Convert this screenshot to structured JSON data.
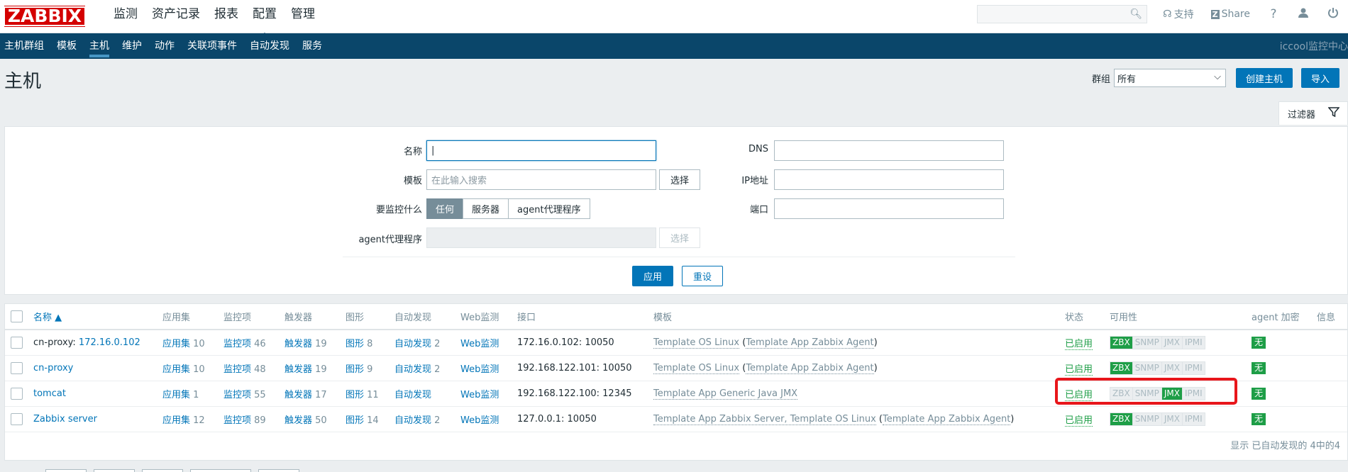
{
  "logo": "ZABBIX",
  "topmenu": [
    "监测",
    "资产记录",
    "报表",
    "配置",
    "管理"
  ],
  "topright": {
    "support": "支持",
    "share": "Share",
    "help": "?"
  },
  "subnav": [
    "主机群组",
    "模板",
    "主机",
    "维护",
    "动作",
    "关联项事件",
    "自动发现",
    "服务"
  ],
  "subnav_right": "iccool监控中心",
  "page_title": "主机",
  "group_label": "群组",
  "group_value": "所有",
  "create_host": "创建主机",
  "import": "导入",
  "filter_tab": "过滤器",
  "filter": {
    "name_label": "名称",
    "template_label": "模板",
    "template_placeholder": "在此输入搜索",
    "select": "选择",
    "monitor_label": "要监控什么",
    "monitor_opts": [
      "任何",
      "服务器",
      "agent代理程序"
    ],
    "proxy_label": "agent代理程序",
    "dns_label": "DNS",
    "ip_label": "IP地址",
    "port_label": "端口",
    "apply": "应用",
    "reset": "重设"
  },
  "table": {
    "headers": [
      "名称 ▲",
      "应用集",
      "监控项",
      "触发器",
      "图形",
      "自动发现",
      "Web监测",
      "接口",
      "模板",
      "状态",
      "可用性",
      "agent 加密",
      "信息"
    ],
    "rows": [
      {
        "name_prefix": "cn-proxy: ",
        "name_link": "172.16.0.102",
        "apps": "应用集",
        "apps_n": "10",
        "items": "监控项",
        "items_n": "46",
        "triggers": "触发器",
        "triggers_n": "19",
        "graphs": "图形",
        "graphs_n": "8",
        "discovery": "自动发现",
        "discovery_n": "2",
        "web": "Web监测",
        "iface": "172.16.0.102: 10050",
        "tpl_a": "Template OS Linux",
        "tpl_paren": "Template App Zabbix Agent",
        "status": "已启用",
        "av": [
          "ZBX",
          "SNMP",
          "JMX",
          "IPMI"
        ],
        "av_green": "ZBX",
        "enc": "无"
      },
      {
        "name_prefix": "",
        "name_link": "cn-proxy",
        "apps": "应用集",
        "apps_n": "10",
        "items": "监控项",
        "items_n": "48",
        "triggers": "触发器",
        "triggers_n": "19",
        "graphs": "图形",
        "graphs_n": "9",
        "discovery": "自动发现",
        "discovery_n": "2",
        "web": "Web监测",
        "iface": "192.168.122.101: 10050",
        "tpl_a": "Template OS Linux",
        "tpl_paren": "Template App Zabbix Agent",
        "status": "已启用",
        "av": [
          "ZBX",
          "SNMP",
          "JMX",
          "IPMI"
        ],
        "av_green": "ZBX",
        "enc": "无"
      },
      {
        "name_prefix": "",
        "name_link": "tomcat",
        "apps": "应用集",
        "apps_n": "1",
        "items": "监控项",
        "items_n": "55",
        "triggers": "触发器",
        "triggers_n": "17",
        "graphs": "图形",
        "graphs_n": "11",
        "discovery": "自动发现",
        "discovery_n": "",
        "web": "Web监测",
        "iface": "192.168.122.100: 12345",
        "tpl_a": "Template App Generic Java JMX",
        "tpl_paren": "",
        "status": "已启用",
        "av": [
          "ZBX",
          "SNMP",
          "JMX",
          "IPMI"
        ],
        "av_green": "JMX",
        "enc": "无"
      },
      {
        "name_prefix": "",
        "name_link": "Zabbix server",
        "apps": "应用集",
        "apps_n": "12",
        "items": "监控项",
        "items_n": "89",
        "triggers": "触发器",
        "triggers_n": "50",
        "graphs": "图形",
        "graphs_n": "14",
        "discovery": "自动发现",
        "discovery_n": "2",
        "web": "Web监测",
        "iface": "127.0.0.1: 10050",
        "tpl_a": "Template App Zabbix Server, Template OS Linux",
        "tpl_paren": "Template App Zabbix Agent",
        "status": "已启用",
        "av": [
          "ZBX",
          "SNMP",
          "JMX",
          "IPMI"
        ],
        "av_green": "ZBX",
        "enc": "无"
      }
    ],
    "footer": "显示 已自动发现的 4中的4"
  },
  "colors": {
    "brand": "#d40000",
    "nav": "#0a466a",
    "link": "#0275b8",
    "ok": "#1e9e47",
    "highlight": "#e8161b"
  }
}
